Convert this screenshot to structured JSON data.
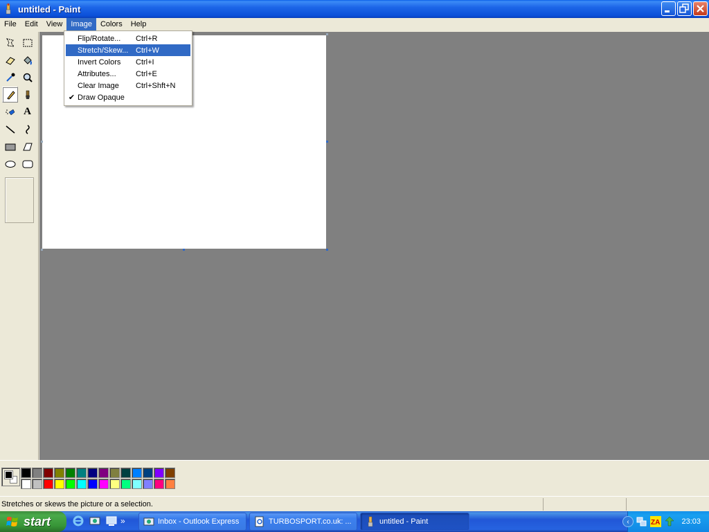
{
  "window": {
    "title": "untitled - Paint"
  },
  "menubar": {
    "items": [
      "File",
      "Edit",
      "View",
      "Image",
      "Colors",
      "Help"
    ],
    "active": "Image"
  },
  "image_menu": {
    "items": [
      {
        "label": "Flip/Rotate...",
        "shortcut": "Ctrl+R",
        "checked": false,
        "highlighted": false
      },
      {
        "label": "Stretch/Skew...",
        "shortcut": "Ctrl+W",
        "checked": false,
        "highlighted": true
      },
      {
        "label": "Invert Colors",
        "shortcut": "Ctrl+I",
        "checked": false,
        "highlighted": false
      },
      {
        "label": "Attributes...",
        "shortcut": "Ctrl+E",
        "checked": false,
        "highlighted": false
      },
      {
        "label": "Clear Image",
        "shortcut": "Ctrl+Shft+N",
        "checked": false,
        "highlighted": false
      },
      {
        "label": "Draw Opaque",
        "shortcut": "",
        "checked": true,
        "highlighted": false
      }
    ],
    "check_glyph": "✔"
  },
  "toolbox": {
    "tools": [
      "free-form-select",
      "select",
      "eraser",
      "fill-with-color",
      "pick-color",
      "magnifier",
      "pencil",
      "brush",
      "airbrush",
      "text",
      "line",
      "curve",
      "rectangle",
      "polygon",
      "ellipse",
      "rounded-rectangle"
    ],
    "selected": "pencil",
    "text_tool_glyph": "A"
  },
  "palette": {
    "foreground": "#000000",
    "background": "#FFFFFF",
    "row1": [
      "#000000",
      "#808080",
      "#800000",
      "#808000",
      "#008000",
      "#008080",
      "#000080",
      "#800080",
      "#808040",
      "#004040",
      "#0080FF",
      "#004080",
      "#8000FF",
      "#804000"
    ],
    "row2": [
      "#FFFFFF",
      "#C0C0C0",
      "#FF0000",
      "#FFFF00",
      "#00FF00",
      "#00FFFF",
      "#0000FF",
      "#FF00FF",
      "#FFFF80",
      "#00FF80",
      "#80FFFF",
      "#8080FF",
      "#FF0080",
      "#FF8040"
    ]
  },
  "statusbar": {
    "text": "Stretches or skews the picture or a selection."
  },
  "taskbar": {
    "start_label": "start",
    "quicklaunch": [
      "internet-explorer-icon",
      "outlook-express-icon",
      "show-desktop-icon"
    ],
    "more_glyph": "»",
    "tasks": [
      {
        "label": "Inbox - Outlook Express",
        "icon": "outlook-express-icon",
        "active": false
      },
      {
        "label": "TURBOSPORT.co.uk: ...",
        "icon": "ie-page-icon",
        "active": false
      },
      {
        "label": "untitled - Paint",
        "icon": "paint-icon",
        "active": true
      }
    ],
    "tray_icons": [
      "network-icon",
      "zonealarm-icon",
      "update-icon"
    ],
    "clock": "23:03"
  },
  "colors": {
    "workspace": "#808080",
    "menu_highlight": "#316AC5"
  }
}
